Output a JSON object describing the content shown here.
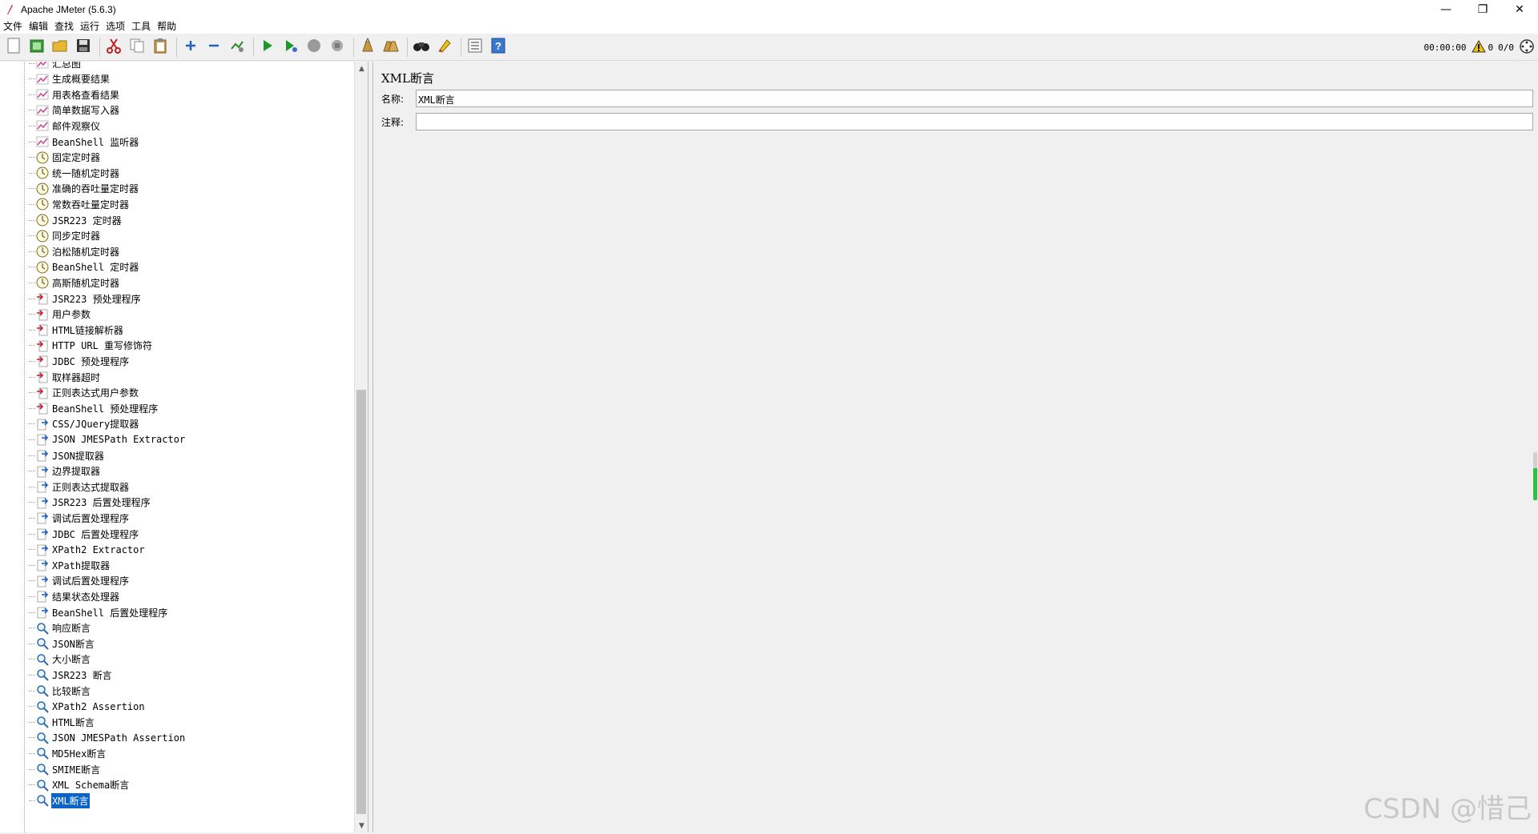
{
  "window": {
    "title": "Apache JMeter (5.6.3)",
    "minimize": "—",
    "restore": "❐",
    "close": "✕"
  },
  "menu": [
    {
      "label": "文件"
    },
    {
      "label": "编辑"
    },
    {
      "label": "查找"
    },
    {
      "label": "运行"
    },
    {
      "label": "选项"
    },
    {
      "label": "工具"
    },
    {
      "label": "帮助"
    }
  ],
  "toolbar": {
    "buttons": [
      {
        "name": "new-icon",
        "group": 0
      },
      {
        "name": "templates-icon",
        "group": 0
      },
      {
        "name": "open-icon",
        "group": 0
      },
      {
        "name": "save-icon",
        "group": 0
      },
      {
        "name": "cut-icon",
        "group": 1
      },
      {
        "name": "copy-icon",
        "group": 1
      },
      {
        "name": "paste-icon",
        "group": 1
      },
      {
        "name": "expand-icon",
        "group": 2
      },
      {
        "name": "collapse-icon",
        "group": 2
      },
      {
        "name": "toggle-icon",
        "group": 2
      },
      {
        "name": "start-icon",
        "group": 3
      },
      {
        "name": "start-no-pause-icon",
        "group": 3
      },
      {
        "name": "stop-icon",
        "group": 3
      },
      {
        "name": "shutdown-icon",
        "group": 3
      },
      {
        "name": "clear-icon",
        "group": 4
      },
      {
        "name": "clear-all-icon",
        "group": 4
      },
      {
        "name": "search-icon",
        "group": 5
      },
      {
        "name": "reset-search-icon",
        "group": 5
      },
      {
        "name": "function-helper-icon",
        "group": 6
      },
      {
        "name": "help-icon",
        "group": 6
      }
    ],
    "timer": "00:00:00",
    "warnings": "0",
    "threads": "0/0"
  },
  "tree": {
    "items": [
      {
        "label": "汇总图",
        "icon": "listener"
      },
      {
        "label": "生成概要结果",
        "icon": "listener"
      },
      {
        "label": "用表格查看结果",
        "icon": "listener"
      },
      {
        "label": "简单数据写入器",
        "icon": "listener"
      },
      {
        "label": "邮件观察仪",
        "icon": "listener"
      },
      {
        "label": "BeanShell 监听器",
        "icon": "listener"
      },
      {
        "label": "固定定时器",
        "icon": "timer"
      },
      {
        "label": "统一随机定时器",
        "icon": "timer"
      },
      {
        "label": "准确的吞吐量定时器",
        "icon": "timer"
      },
      {
        "label": "常数吞吐量定时器",
        "icon": "timer"
      },
      {
        "label": "JSR223 定时器",
        "icon": "timer"
      },
      {
        "label": "同步定时器",
        "icon": "timer"
      },
      {
        "label": "泊松随机定时器",
        "icon": "timer"
      },
      {
        "label": "BeanShell 定时器",
        "icon": "timer"
      },
      {
        "label": "高斯随机定时器",
        "icon": "timer"
      },
      {
        "label": "JSR223 预处理程序",
        "icon": "preprocessor"
      },
      {
        "label": "用户参数",
        "icon": "preprocessor"
      },
      {
        "label": "HTML链接解析器",
        "icon": "preprocessor"
      },
      {
        "label": "HTTP URL 重写修饰符",
        "icon": "preprocessor"
      },
      {
        "label": "JDBC 预处理程序",
        "icon": "preprocessor"
      },
      {
        "label": "取样器超时",
        "icon": "preprocessor"
      },
      {
        "label": "正则表达式用户参数",
        "icon": "preprocessor"
      },
      {
        "label": "BeanShell 预处理程序",
        "icon": "preprocessor"
      },
      {
        "label": "CSS/JQuery提取器",
        "icon": "postprocessor"
      },
      {
        "label": "JSON JMESPath Extractor",
        "icon": "postprocessor"
      },
      {
        "label": "JSON提取器",
        "icon": "postprocessor"
      },
      {
        "label": "边界提取器",
        "icon": "postprocessor"
      },
      {
        "label": "正则表达式提取器",
        "icon": "postprocessor"
      },
      {
        "label": "JSR223 后置处理程序",
        "icon": "postprocessor"
      },
      {
        "label": "调试后置处理程序",
        "icon": "postprocessor"
      },
      {
        "label": "JDBC 后置处理程序",
        "icon": "postprocessor"
      },
      {
        "label": "XPath2 Extractor",
        "icon": "postprocessor"
      },
      {
        "label": "XPath提取器",
        "icon": "postprocessor"
      },
      {
        "label": "调试后置处理程序",
        "icon": "postprocessor"
      },
      {
        "label": "结果状态处理器",
        "icon": "postprocessor"
      },
      {
        "label": "BeanShell 后置处理程序",
        "icon": "postprocessor"
      },
      {
        "label": "响应断言",
        "icon": "assertion"
      },
      {
        "label": "JSON断言",
        "icon": "assertion"
      },
      {
        "label": "大小断言",
        "icon": "assertion"
      },
      {
        "label": "JSR223 断言",
        "icon": "assertion"
      },
      {
        "label": "比较断言",
        "icon": "assertion"
      },
      {
        "label": "XPath2 Assertion",
        "icon": "assertion"
      },
      {
        "label": "HTML断言",
        "icon": "assertion"
      },
      {
        "label": "JSON JMESPath Assertion",
        "icon": "assertion"
      },
      {
        "label": "MD5Hex断言",
        "icon": "assertion"
      },
      {
        "label": "SMIME断言",
        "icon": "assertion"
      },
      {
        "label": "XML Schema断言",
        "icon": "assertion"
      },
      {
        "label": "XML断言",
        "icon": "assertion",
        "selected": true
      }
    ]
  },
  "panel": {
    "title": "XML断言",
    "name_label": "名称:",
    "name_value": "XML断言",
    "comment_label": "注释:",
    "comment_value": ""
  },
  "watermark": "CSDN @惜己"
}
